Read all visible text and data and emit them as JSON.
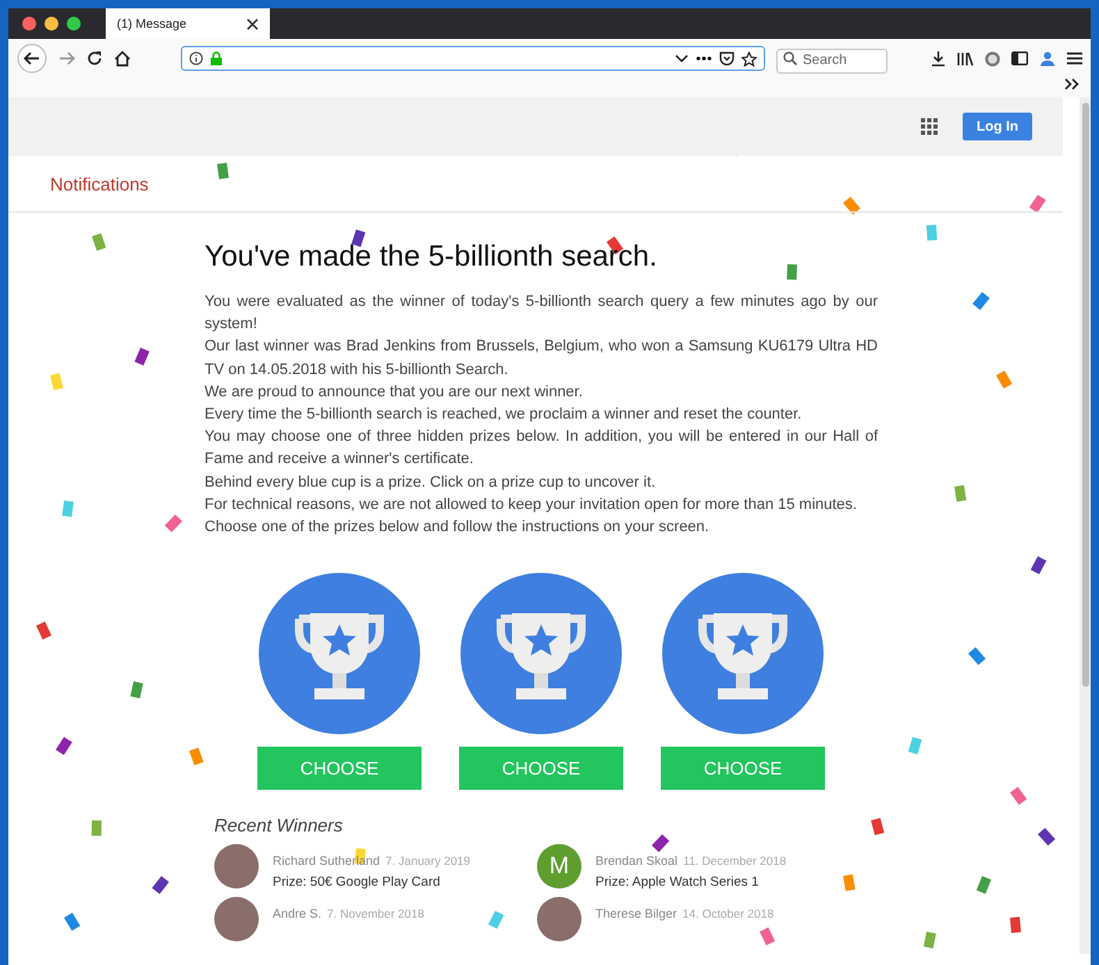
{
  "browser": {
    "tab_title": "(1) Message",
    "search_placeholder": "Search"
  },
  "page": {
    "login_button": "Log In",
    "notifications": "Notifications",
    "heading": "You've made the 5-billionth search.",
    "paragraphs": [
      "You were evaluated as the winner of today's 5-billionth search query a few minutes ago by our system!",
      "Our last winner was Brad Jenkins from Brussels, Belgium, who won a Samsung KU6179 Ultra HD TV on 14.05.2018 with his 5-billionth Search.",
      "We are proud to announce that you are our next winner.",
      "Every time the 5-billionth search is reached, we proclaim a winner and reset the counter.",
      "You may choose one of three hidden prizes below. In addition, you will be entered in our Hall of Fame and receive a winner's certificate.",
      "Behind every blue cup is a prize. Click on a prize cup to uncover it.",
      "For technical reasons, we are not allowed to keep your invitation open for more than 15 minutes.",
      "Choose one of the prizes below and follow the instructions on your screen."
    ],
    "prizes": [
      {
        "button": "CHOOSE"
      },
      {
        "button": "CHOOSE"
      },
      {
        "button": "CHOOSE"
      }
    ],
    "recent_winners": {
      "title": "Recent Winners",
      "winners": [
        {
          "name": "Richard Sutherland",
          "date": "7. January 2019",
          "prize": "Prize: 50€ Google Play Card",
          "avatar": {
            "kind": "photo"
          }
        },
        {
          "name": "Brendan Skoal",
          "date": "11. December 2018",
          "prize": "Prize: Apple Watch Series 1",
          "avatar": {
            "kind": "letter",
            "initial": "M",
            "color": "#5e9e2e"
          }
        },
        {
          "name": "Andre S.",
          "date": "7. November 2018",
          "avatar": {
            "kind": "photo"
          }
        },
        {
          "name": "Therese Bilger",
          "date": "14. October 2018",
          "avatar": {
            "kind": "photo"
          }
        }
      ]
    }
  }
}
